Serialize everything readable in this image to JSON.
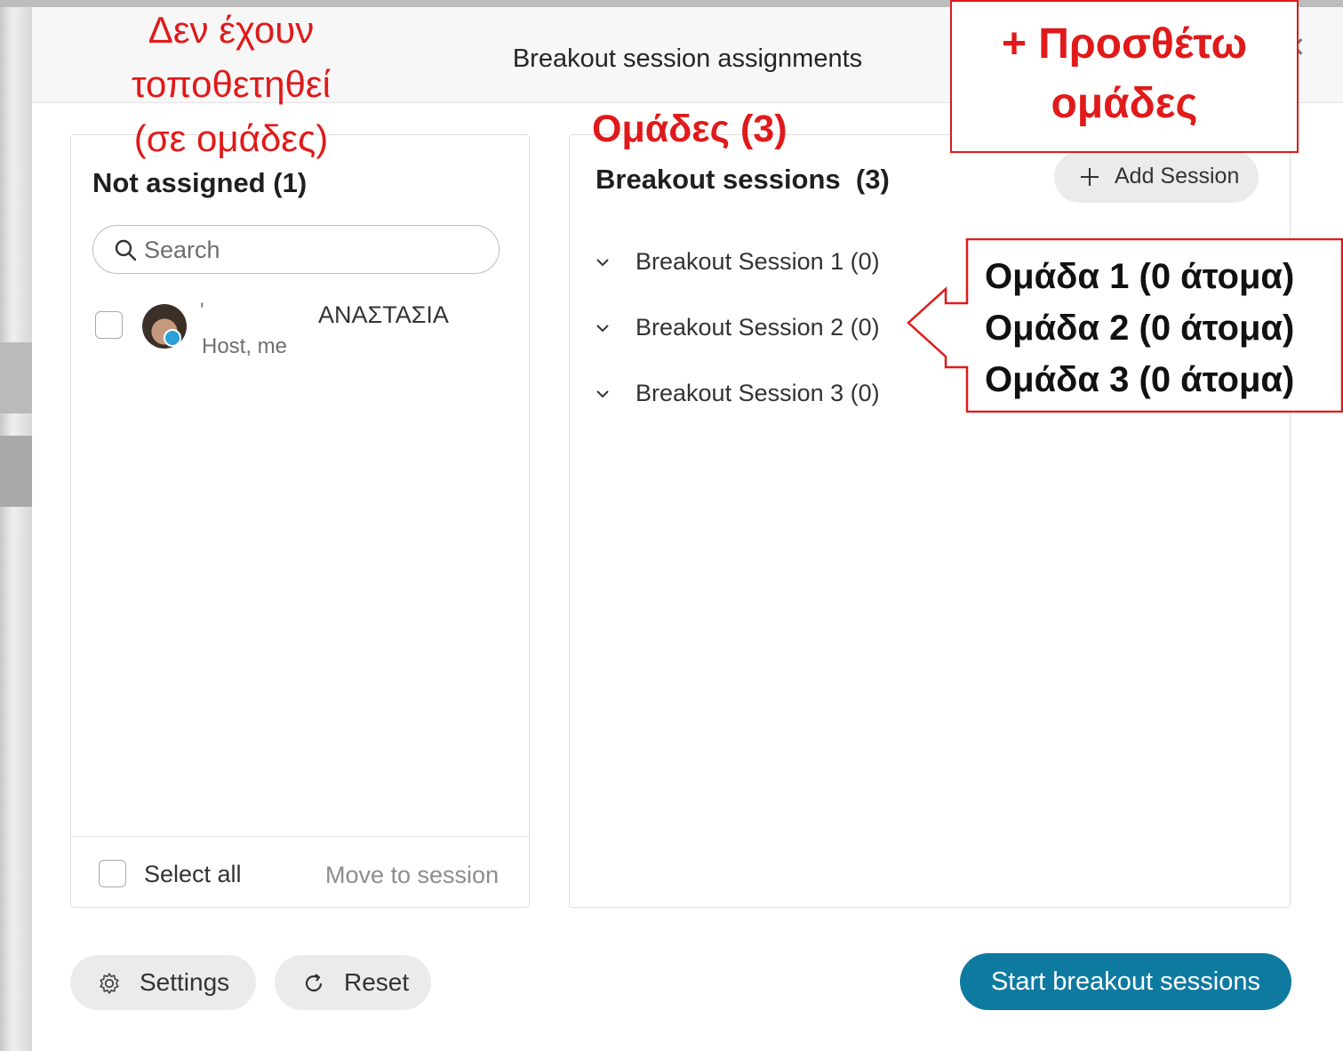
{
  "dialog": {
    "title": "Breakout session assignments",
    "close_icon": "close-icon",
    "accent_color": "#0f7aa0"
  },
  "not_assigned": {
    "title": "Not assigned (1)",
    "search_placeholder": "Search",
    "search_value": "",
    "participants": [
      {
        "tick": "'",
        "name": "ΑΝΑΣΤΑΣΙΑ",
        "role": "Host, me",
        "checked": false
      }
    ],
    "select_all_label": "Select all",
    "move_label": "Move to session"
  },
  "breakout": {
    "title": "Breakout sessions  (3)",
    "add_label": "Add Session",
    "sessions": [
      {
        "label": "Breakout Session 1 (0)"
      },
      {
        "label": "Breakout Session 2 (0)"
      },
      {
        "label": "Breakout Session 3 (0)"
      }
    ]
  },
  "footer": {
    "settings_label": "Settings",
    "reset_label": "Reset",
    "start_label": "Start breakout sessions"
  },
  "annotations": {
    "color": "#e01a1a",
    "not_assigned_note": "Δεν έχουν\nτοποθετηθεί\n(σε ομάδες)",
    "groups_note": "Ομάδες (3)",
    "add_groups_note": "+ Προσθέτω\nομάδες",
    "callout_lines": [
      "Ομάδα 1 (0 άτομα)",
      "Ομάδα 2 (0 άτομα)",
      "Ομάδα 3 (0 άτομα)"
    ]
  }
}
